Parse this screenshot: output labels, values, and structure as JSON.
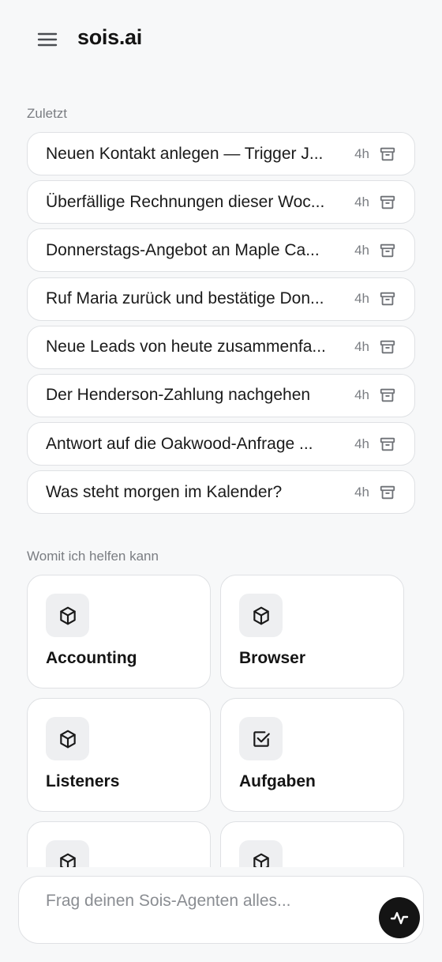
{
  "app": {
    "brand": "sois.ai"
  },
  "recent": {
    "label": "Zuletzt",
    "items": [
      {
        "title": "Neuen Kontakt anlegen — Trigger J...",
        "time": "4h"
      },
      {
        "title": "Überfällige Rechnungen dieser Woc...",
        "time": "4h"
      },
      {
        "title": "Donnerstags-Angebot an Maple Ca...",
        "time": "4h"
      },
      {
        "title": "Ruf Maria zurück und bestätige Don...",
        "time": "4h"
      },
      {
        "title": "Neue Leads von heute zusammenfa...",
        "time": "4h"
      },
      {
        "title": "Der Henderson-Zahlung nachgehen",
        "time": "4h"
      },
      {
        "title": "Antwort auf die Oakwood-Anfrage ...",
        "time": "4h"
      },
      {
        "title": "Was steht morgen im Kalender?",
        "time": "4h"
      }
    ]
  },
  "help": {
    "label": "Womit ich helfen kann",
    "cards": [
      {
        "label": "Accounting",
        "icon": "cube-icon"
      },
      {
        "label": "Browser",
        "icon": "cube-icon"
      },
      {
        "label": "Listeners",
        "icon": "cube-icon"
      },
      {
        "label": "Aufgaben",
        "icon": "checkbox-icon"
      },
      {
        "label": "",
        "icon": "cube-icon"
      },
      {
        "label": "",
        "icon": "cube-icon"
      }
    ]
  },
  "composer": {
    "placeholder": "Frag deinen Sois-Agenten alles..."
  },
  "icons": {
    "menu": "hamburger-menu-icon",
    "archive": "archive-icon",
    "send": "activity-wave-icon"
  },
  "colors": {
    "background": "#f7f8f9",
    "text": "#141414",
    "muted": "#7a7d82",
    "border": "#dfe1e4",
    "icon_tile": "#eeeff1",
    "send_button": "#141414"
  }
}
